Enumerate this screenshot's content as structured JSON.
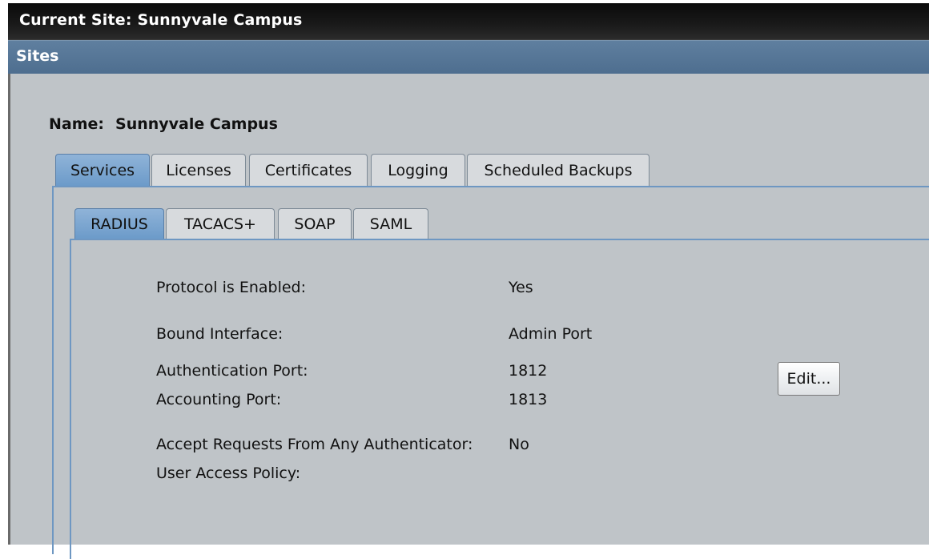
{
  "title_bar": {
    "current_site": "Current Site:  Sunnyvale Campus"
  },
  "sites_header": {
    "title": "Sites"
  },
  "site": {
    "name_label": "Name:",
    "name_value": "Sunnyvale Campus"
  },
  "tabs": [
    {
      "label": "Services",
      "active": true
    },
    {
      "label": "Licenses",
      "active": false
    },
    {
      "label": "Certificates",
      "active": false
    },
    {
      "label": "Logging",
      "active": false
    },
    {
      "label": "Scheduled Backups",
      "active": false
    }
  ],
  "service_tabs": [
    {
      "label": "RADIUS",
      "active": true
    },
    {
      "label": "TACACS+",
      "active": false
    },
    {
      "label": "SOAP",
      "active": false
    },
    {
      "label": "SAML",
      "active": false
    }
  ],
  "radius": {
    "protocol_enabled_label": "Protocol is Enabled:",
    "protocol_enabled_value": "Yes",
    "bound_interface_label": "Bound Interface:",
    "bound_interface_value": "Admin Port",
    "auth_port_label": "Authentication Port:",
    "auth_port_value": "1812",
    "acct_port_label": "Accounting Port:",
    "acct_port_value": "1813",
    "accept_any_label": "Accept Requests From Any Authenticator:",
    "accept_any_value": "No",
    "user_access_policy_label": "User Access Policy:",
    "user_access_policy_value": "",
    "edit_button": "Edit..."
  },
  "colors": {
    "active_tab": "#6b9ac9",
    "header_blue": "#4e6e8f",
    "panel_gray": "#bfc4c8"
  }
}
